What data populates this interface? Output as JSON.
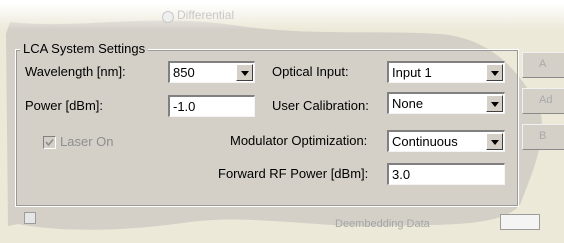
{
  "faded_top": {
    "radio_label": "Differential"
  },
  "group": {
    "title": "LCA System Settings"
  },
  "fields": {
    "wavelength": {
      "label": "Wavelength [nm]:",
      "value": "850"
    },
    "power": {
      "label": "Power [dBm]:",
      "value": "-1.0"
    },
    "laser_on": {
      "label": "Laser On",
      "checked": true,
      "enabled": false
    },
    "optical_input": {
      "label": "Optical Input:",
      "value": "Input 1"
    },
    "user_calibration": {
      "label": "User Calibration:",
      "value": "None"
    },
    "modulator_optimization": {
      "label": "Modulator Optimization:",
      "value": "Continuous"
    },
    "forward_rf_power": {
      "label": "Forward RF Power [dBm]:",
      "value": "3.0"
    }
  },
  "right_edge_buttons": [
    "A",
    "Ad",
    "B"
  ],
  "bottom_faded": {
    "deembedding_label": "Deembedding Data"
  }
}
